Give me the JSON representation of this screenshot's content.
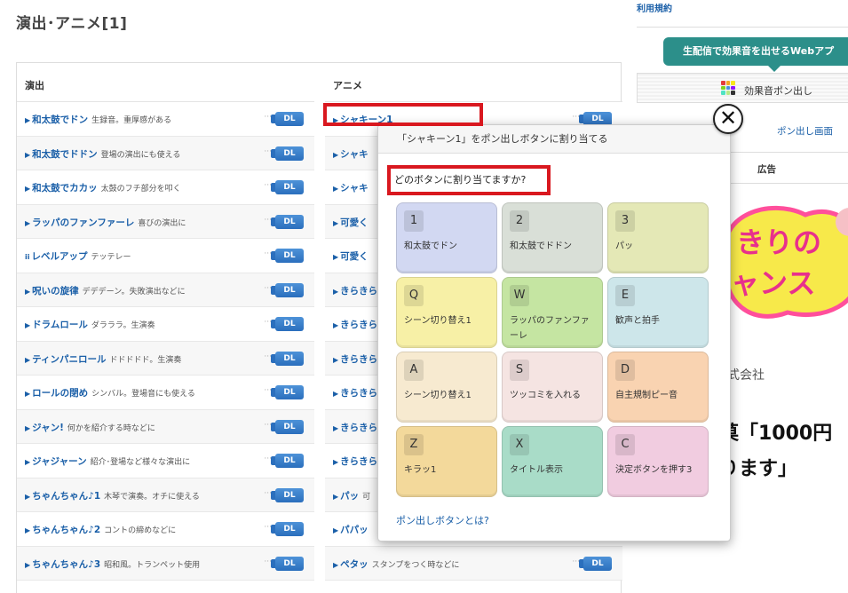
{
  "page": {
    "title": "演出･アニメ[1]"
  },
  "columns": {
    "left_header": "演出",
    "right_header": "アニメ",
    "left_items": [
      {
        "name": "和太鼓でドン",
        "desc": "生録音。重厚感がある",
        "prefix": "▶"
      },
      {
        "name": "和太鼓でドドン",
        "desc": "登場の演出にも使える",
        "prefix": "▶"
      },
      {
        "name": "和太鼓でカカッ",
        "desc": "太鼓のフチ部分を叩く",
        "prefix": "▶"
      },
      {
        "name": "ラッパのファンファーレ",
        "desc": "喜びの演出に",
        "prefix": "▶"
      },
      {
        "name": "レベルアップ",
        "desc": "テッテレー",
        "prefix": "ii"
      },
      {
        "name": "呪いの旋律",
        "desc": "デデデーン。失敗演出などに",
        "prefix": "▶"
      },
      {
        "name": "ドラムロール",
        "desc": "ダラララ。生演奏",
        "prefix": "▶"
      },
      {
        "name": "ティンパニロール",
        "desc": "ドドドドド。生演奏",
        "prefix": "▶"
      },
      {
        "name": "ロールの閉め",
        "desc": "シンバル。登場音にも使える",
        "prefix": "▶"
      },
      {
        "name": "ジャン!",
        "desc": "何かを紹介する時などに",
        "prefix": "▶"
      },
      {
        "name": "ジャジャーン",
        "desc": "紹介･登場など様々な演出に",
        "prefix": "▶"
      },
      {
        "name": "ちゃんちゃん♪1",
        "desc": "木琴で演奏。オチに使える",
        "prefix": "▶"
      },
      {
        "name": "ちゃんちゃん♪2",
        "desc": "コントの締めなどに",
        "prefix": "▶"
      },
      {
        "name": "ちゃんちゃん♪3",
        "desc": "昭和風。トランペット使用",
        "prefix": "▶"
      }
    ],
    "right_items": [
      {
        "name": "シャキーン1",
        "desc": "",
        "prefix": "▶"
      },
      {
        "name": "シャキ",
        "desc": "",
        "prefix": "▶"
      },
      {
        "name": "シャキ",
        "desc": "",
        "prefix": "▶"
      },
      {
        "name": "可愛く",
        "desc": "",
        "prefix": "▶"
      },
      {
        "name": "可愛く",
        "desc": "",
        "prefix": "▶"
      },
      {
        "name": "きらきら",
        "desc": "",
        "prefix": "▶"
      },
      {
        "name": "きらきら",
        "desc": "",
        "prefix": "▶"
      },
      {
        "name": "きらきら",
        "desc": "",
        "prefix": "▶"
      },
      {
        "name": "きらきら",
        "desc": "",
        "prefix": "▶"
      },
      {
        "name": "きらきら",
        "desc": "",
        "prefix": "▶"
      },
      {
        "name": "きらきら",
        "desc": "",
        "prefix": "▶"
      },
      {
        "name": "パッ",
        "desc": "可",
        "prefix": "▶"
      },
      {
        "name": "パパッ",
        "desc": "",
        "prefix": "▶"
      },
      {
        "name": "ペタッ",
        "desc": "スタンプをつく時などに",
        "prefix": "▶"
      }
    ],
    "dots": "···",
    "dl_label": "DL"
  },
  "sidebar": {
    "terms_link": "利用規約",
    "banner": "生配信で効果音を出せるWebアプ",
    "pon_box_label": "効果音ポン出し",
    "pon_screen_link": "ポン出し画面",
    "ad_label": "広告",
    "ad_art_line1": "きりの",
    "ad_art_line2": "ャンス",
    "ad_company": "式会社",
    "ad_big_1": "菓「1000円",
    "ad_big_2": "ります」"
  },
  "modal": {
    "header": "「シャキーン1」をポン出しボタンに割り当てる",
    "question": "どのボタンに割り当てますか?",
    "keys": [
      {
        "letter": "1",
        "label": "和太鼓でドン",
        "color": "#d2d8f2"
      },
      {
        "letter": "2",
        "label": "和太鼓でドドン",
        "color": "#d9dfd7"
      },
      {
        "letter": "3",
        "label": "パッ",
        "color": "#e4e8b6"
      },
      {
        "letter": "Q",
        "label": "シーン切り替え1",
        "color": "#f7f0a6"
      },
      {
        "letter": "W",
        "label": "ラッパのファンファーレ",
        "color": "#c5e5a2"
      },
      {
        "letter": "E",
        "label": "歓声と拍手",
        "color": "#cde6ea"
      },
      {
        "letter": "A",
        "label": "シーン切り替え1",
        "color": "#f7ead0"
      },
      {
        "letter": "S",
        "label": "ツッコミを入れる",
        "color": "#f5e4e2"
      },
      {
        "letter": "D",
        "label": "自主規制ピー音",
        "color": "#f9d3b1"
      },
      {
        "letter": "Z",
        "label": "キラッ1",
        "color": "#f3d99b"
      },
      {
        "letter": "X",
        "label": "タイトル表示",
        "color": "#a9dcc8"
      },
      {
        "letter": "C",
        "label": "決定ボタンを押す3",
        "color": "#f1cce0"
      }
    ],
    "footer_link": "ポン出しボタンとは?",
    "close_symbol": "✕"
  },
  "colors": {
    "link_blue": "#1a5fa8",
    "highlight_red": "#d9181f",
    "banner_teal": "#2c8f8a",
    "dl_blue": "#2b6fbd"
  }
}
